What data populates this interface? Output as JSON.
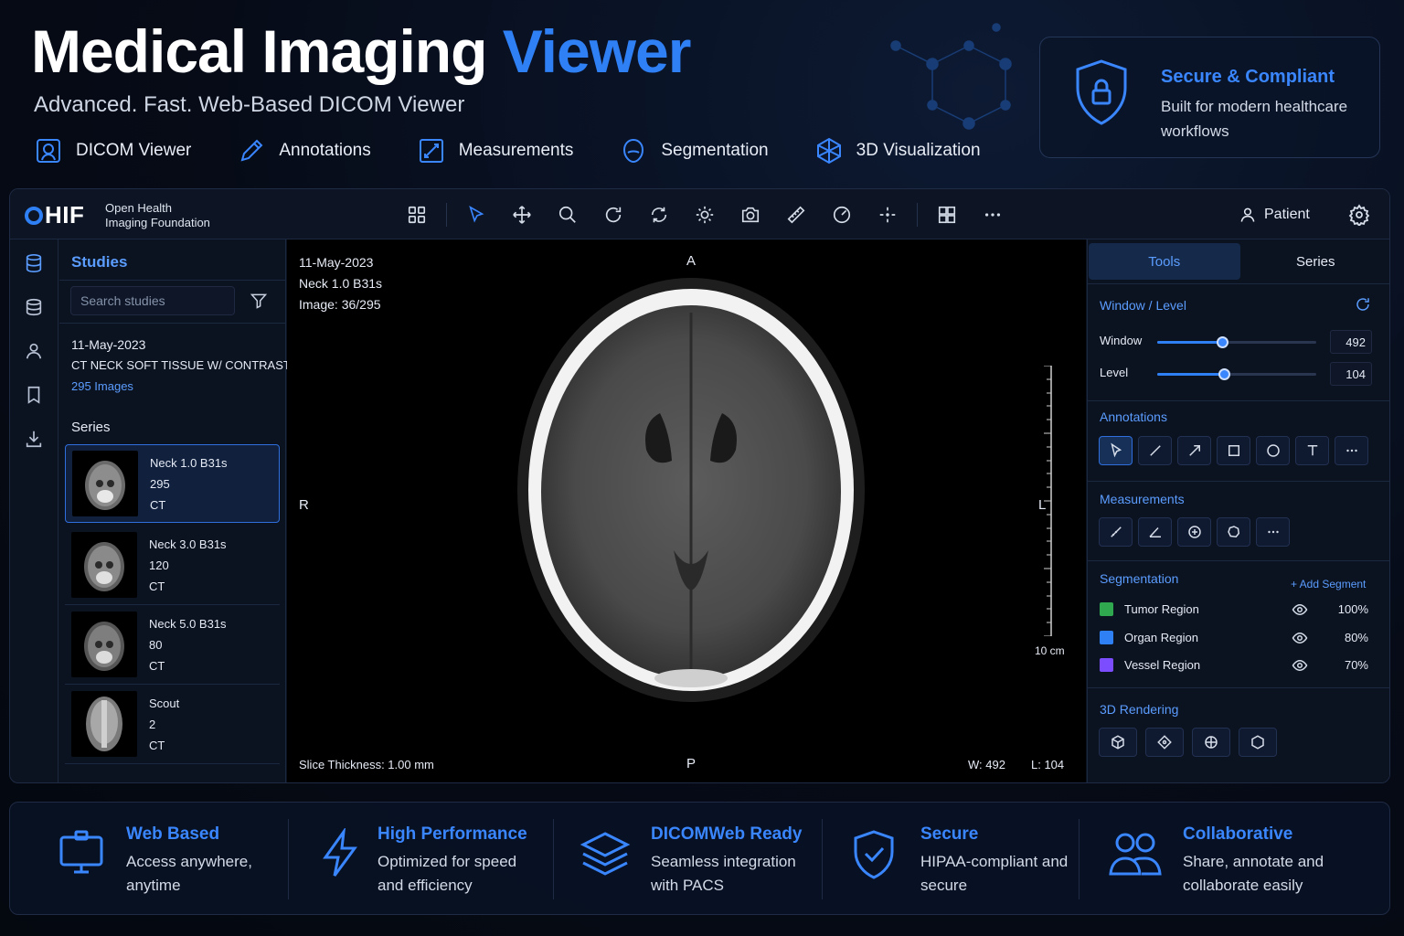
{
  "hero": {
    "title_main": "Medical Imaging ",
    "title_accent": "Viewer",
    "subtitle": "Advanced. Fast. Web-Based DICOM Viewer",
    "features": [
      {
        "label": "DICOM Viewer",
        "icon": "dicom-viewer-icon"
      },
      {
        "label": "Annotations",
        "icon": "pencil-icon"
      },
      {
        "label": "Measurements",
        "icon": "measure-icon"
      },
      {
        "label": "Segmentation",
        "icon": "segmentation-icon"
      },
      {
        "label": "3D Visualization",
        "icon": "cube-icon"
      }
    ]
  },
  "secure_card": {
    "title": "Secure & Compliant",
    "text": "Built for modern healthcare workflows",
    "icon": "shield-lock-icon"
  },
  "app": {
    "logo": "HIF",
    "logo_text_line1": "Open Health",
    "logo_text_line2": "Imaging Foundation",
    "patient_label": "Patient",
    "toolbar": [
      "layout-grid-icon",
      "pointer-icon",
      "pan-icon",
      "zoom-icon",
      "rotate-icon",
      "reset-icon",
      "brightness-icon",
      "camera-icon",
      "ruler-icon",
      "gauge-icon",
      "crosshair-icon",
      "grid-icon",
      "more-icon"
    ]
  },
  "studies": {
    "title": "Studies",
    "search_placeholder": "Search studies",
    "study_date": "11-May-2023",
    "study_desc": "CT NECK SOFT TISSUE W/ CONTRAST",
    "study_count": "295 Images",
    "series_label": "Series",
    "series": [
      {
        "name": "Neck 1.0 B31s",
        "count": "295",
        "modality": "CT"
      },
      {
        "name": "Neck 3.0 B31s",
        "count": "120",
        "modality": "CT"
      },
      {
        "name": "Neck 5.0 B31s",
        "count": "80",
        "modality": "CT"
      },
      {
        "name": "Scout",
        "count": "2",
        "modality": "CT"
      }
    ]
  },
  "viewport": {
    "date": "11-May-2023",
    "series": "Neck 1.0 B31s",
    "image": "Image:  36/295",
    "orient_top": "A",
    "orient_bottom": "P",
    "orient_left": "R",
    "orient_right": "L",
    "scale_label": "10 cm",
    "slice_thickness": "Slice Thickness:  1.00 mm",
    "window": "W: 492",
    "level": "L: 104"
  },
  "right_panel": {
    "tabs": [
      "Tools",
      "Series"
    ],
    "window_level_title": "Window / Level",
    "window_label": "Window",
    "window_value": "492",
    "window_fraction": 0.41,
    "level_label": "Level",
    "level_value": "104",
    "level_fraction": 0.42,
    "annotations_title": "Annotations",
    "measurements_title": "Measurements",
    "segmentation_title": "Segmentation",
    "add_segment": "+ Add Segment",
    "segments": [
      {
        "name": "Tumor Region",
        "pct": "100%",
        "color": "#2fa84f"
      },
      {
        "name": "Organ Region",
        "pct": "80%",
        "color": "#2f7ff5"
      },
      {
        "name": "Vessel Region",
        "pct": "70%",
        "color": "#7c4dff"
      }
    ],
    "rendering_title": "3D Rendering"
  },
  "benefits": [
    {
      "title": "Web Based",
      "text": "Access anywhere, anytime",
      "icon": "monitor-icon"
    },
    {
      "title": "High Performance",
      "text": "Optimized for speed and efficiency",
      "icon": "lightning-icon"
    },
    {
      "title": "DICOMWeb Ready",
      "text": "Seamless integration with PACS",
      "icon": "layers-icon"
    },
    {
      "title": "Secure",
      "text": "HIPAA-compliant and secure",
      "icon": "shield-check-icon"
    },
    {
      "title": "Collaborative",
      "text": "Share, annotate and collaborate easily",
      "icon": "users-icon"
    }
  ],
  "colors": {
    "accent": "#2f7ff5",
    "background": "#060b17",
    "panel": "#0b1220"
  }
}
